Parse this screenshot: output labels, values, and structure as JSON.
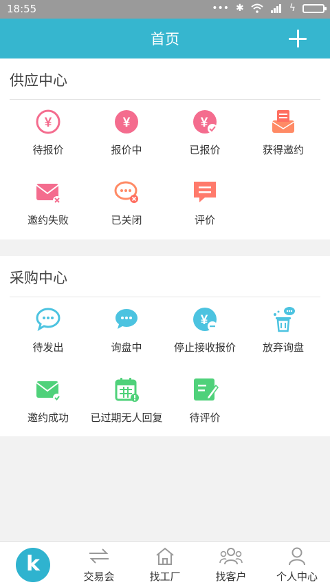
{
  "status": {
    "time": "18:55"
  },
  "header": {
    "title": "首页"
  },
  "supply": {
    "title": "供应中心",
    "items": [
      {
        "label": "待报价",
        "icon": "yen-outline-icon"
      },
      {
        "label": "报价中",
        "icon": "yen-filled-icon"
      },
      {
        "label": "已报价",
        "icon": "yen-check-icon"
      },
      {
        "label": "获得邀约",
        "icon": "invitation-received-icon"
      },
      {
        "label": "邀约失败",
        "icon": "envelope-failed-icon"
      },
      {
        "label": "已关闭",
        "icon": "chat-closed-icon"
      },
      {
        "label": "评价",
        "icon": "review-icon"
      }
    ]
  },
  "purchase": {
    "title": "采购中心",
    "items": [
      {
        "label": "待发出",
        "icon": "chat-outline-icon"
      },
      {
        "label": "询盘中",
        "icon": "chat-filled-icon"
      },
      {
        "label": "停止接收报价",
        "icon": "yen-stop-icon"
      },
      {
        "label": "放弃询盘",
        "icon": "trash-chat-icon"
      },
      {
        "label": "邀约成功",
        "icon": "envelope-success-icon"
      },
      {
        "label": "已过期无人回复",
        "icon": "calendar-expired-icon"
      },
      {
        "label": "待评价",
        "icon": "edit-review-icon"
      }
    ]
  },
  "nav": {
    "logo": "k",
    "items": [
      {
        "label": "交易会",
        "icon": "exchange-icon"
      },
      {
        "label": "找工厂",
        "icon": "home-icon"
      },
      {
        "label": "找客户",
        "icon": "people-icon"
      },
      {
        "label": "个人中心",
        "icon": "user-icon"
      }
    ]
  },
  "colors": {
    "primary": "#36b6cf",
    "pink": "#f46c8e",
    "orange": "#ff8a65",
    "cyan": "#4cc3e0",
    "green": "#4fd17a"
  }
}
